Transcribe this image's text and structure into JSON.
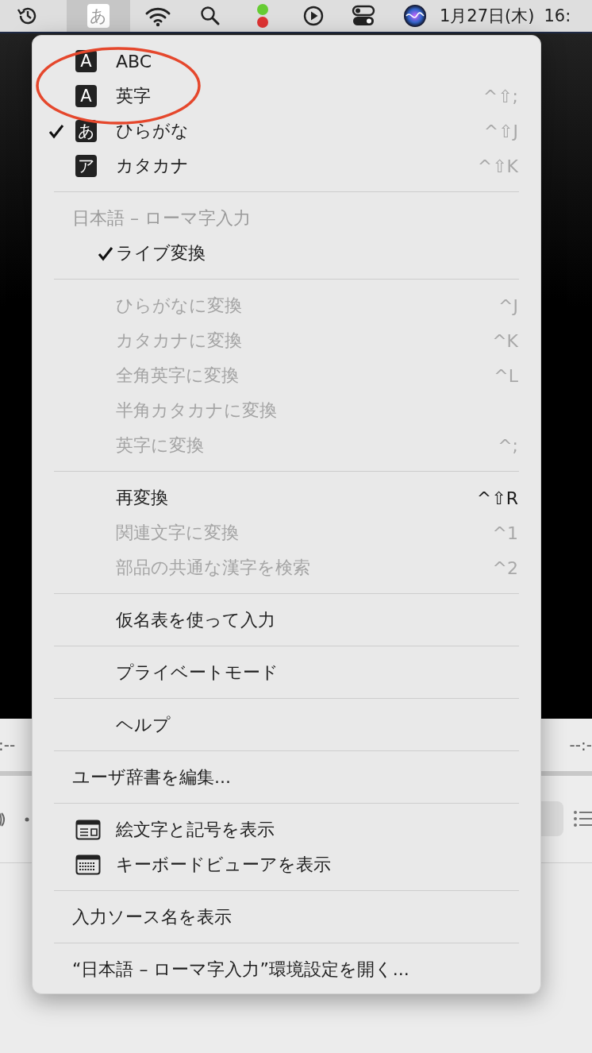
{
  "menu_bar": {
    "input_menu": {
      "label": "あ",
      "selected": true
    },
    "date": "1月27日(木)",
    "time": "16:"
  },
  "background": {
    "left_time": ":--",
    "right_time": "--:-"
  },
  "menu": {
    "sections": [
      [
        {
          "kind": "input_source",
          "badge": "A",
          "label": "ABC",
          "checked": false
        },
        {
          "kind": "input_source",
          "badge": "A",
          "label": "英字",
          "shortcut": "^⇧;",
          "checked": false
        },
        {
          "kind": "input_source",
          "badge": "あ",
          "label": "ひらがな",
          "shortcut": "^⇧J",
          "checked": true
        },
        {
          "kind": "input_source",
          "badge": "ア",
          "label": "カタカナ",
          "shortcut": "^⇧K",
          "checked": false
        }
      ],
      [
        {
          "kind": "header",
          "label": "日本語 – ローマ字入力"
        },
        {
          "kind": "option",
          "label": "ライブ変換",
          "checked": true,
          "disabled": false
        }
      ],
      [
        {
          "kind": "option",
          "label": "ひらがなに変換",
          "shortcut": "^J",
          "checked": false,
          "disabled": true
        },
        {
          "kind": "option",
          "label": "カタカナに変換",
          "shortcut": "^K",
          "checked": false,
          "disabled": true
        },
        {
          "kind": "option",
          "label": "全角英字に変換",
          "shortcut": "^L",
          "checked": false,
          "disabled": true
        },
        {
          "kind": "option",
          "label": "半角カタカナに変換",
          "checked": false,
          "disabled": true
        },
        {
          "kind": "option",
          "label": "英字に変換",
          "shortcut": "^;",
          "checked": false,
          "disabled": true
        }
      ],
      [
        {
          "kind": "option",
          "label": "再変換",
          "shortcut": "^⇧R",
          "checked": false,
          "disabled": false
        },
        {
          "kind": "option",
          "label": "関連文字に変換",
          "shortcut": "^1",
          "checked": false,
          "disabled": true
        },
        {
          "kind": "option",
          "label": "部品の共通な漢字を検索",
          "shortcut": "^2",
          "checked": false,
          "disabled": true
        }
      ],
      [
        {
          "kind": "option",
          "label": "仮名表を使って入力",
          "checked": false,
          "disabled": false
        }
      ],
      [
        {
          "kind": "option",
          "label": "プライベートモード",
          "checked": false,
          "disabled": false
        }
      ],
      [
        {
          "kind": "option",
          "label": "ヘルプ",
          "checked": false,
          "disabled": false
        }
      ],
      [
        {
          "kind": "command",
          "label": "ユーザ辞書を編集..."
        }
      ],
      [
        {
          "kind": "palette",
          "label": "絵文字と記号を表示"
        },
        {
          "kind": "keyboard",
          "label": "キーボードビューアを表示"
        }
      ],
      [
        {
          "kind": "command",
          "label": "入力ソース名を表示"
        }
      ],
      [
        {
          "kind": "command",
          "label": "“日本語 – ローマ字入力”環境設定を開く..."
        }
      ]
    ]
  }
}
